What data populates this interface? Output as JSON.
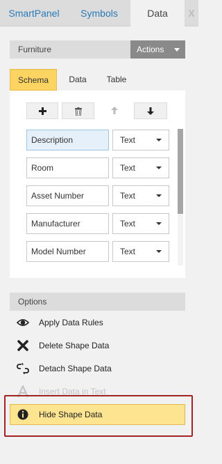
{
  "tabs": [
    {
      "label": "SmartPanel",
      "active": false
    },
    {
      "label": "Symbols",
      "active": false
    },
    {
      "label": "Data",
      "active": true
    }
  ],
  "close_label": "X",
  "furniture": {
    "title": "Furniture",
    "actions_label": "Actions"
  },
  "subtabs": [
    {
      "label": "Schema",
      "active": true
    },
    {
      "label": "Data",
      "active": false
    },
    {
      "label": "Table",
      "active": false
    }
  ],
  "toolbar": {
    "add": "add-icon",
    "delete": "trash-icon",
    "move_up": "arrow-up-icon",
    "move_down": "arrow-down-icon"
  },
  "fields": [
    {
      "name": "Description",
      "type": "Text",
      "selected": true
    },
    {
      "name": "Room",
      "type": "Text",
      "selected": false
    },
    {
      "name": "Asset Number",
      "type": "Text",
      "selected": false
    },
    {
      "name": "Manufacturer",
      "type": "Text",
      "selected": false
    },
    {
      "name": "Model Number",
      "type": "Text",
      "selected": false
    }
  ],
  "options": {
    "title": "Options",
    "items": [
      {
        "label": "Apply Data Rules",
        "icon": "eye-icon",
        "disabled": false
      },
      {
        "label": "Delete Shape Data",
        "icon": "x-icon",
        "disabled": false
      },
      {
        "label": "Detach Shape Data",
        "icon": "broken-link-icon",
        "disabled": false
      },
      {
        "label": "Insert Data in Text",
        "icon": "text-a-icon",
        "disabled": true
      },
      {
        "label": "Hide Shape Data",
        "icon": "info-icon",
        "disabled": false,
        "highlighted": true
      }
    ]
  },
  "colors": {
    "accent": "#2a7ab8",
    "highlight": "#fde491",
    "outline": "#a52222"
  }
}
